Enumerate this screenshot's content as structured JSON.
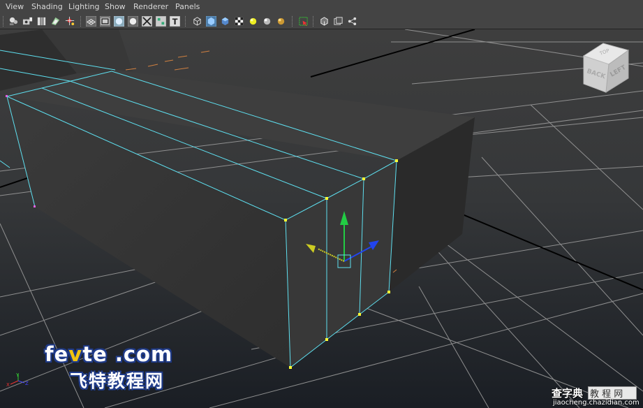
{
  "menu": [
    "View",
    "Shading",
    "Lighting",
    "Show",
    "Renderer",
    "Panels"
  ],
  "toolbar_icons": [
    "select-camera-icon",
    "camera-attributes-icon",
    "bookmark-icon",
    "image-plane-icon",
    "2d-pan-zoom-icon",
    "grid-icon",
    "film-gate-icon",
    "resolution-gate-icon",
    "gate-mask-icon",
    "field-chart-icon",
    "safe-action-icon",
    "wireframe-icon",
    "smooth-shade-icon",
    "default-material-icon",
    "textured-icon",
    "default-lighting-icon",
    "all-lights-icon",
    "shadows-icon",
    "isolate-select-icon",
    "xray-icon",
    "xray-joints-icon",
    "backface-culling-icon"
  ],
  "view_cube": {
    "top_label": "TOP",
    "face_left": "BACK",
    "face_right": "LEFT"
  },
  "axis_labels": {
    "x": "X",
    "y": "Y",
    "z": "Z"
  },
  "watermark": {
    "brand_pre": "fe",
    "brand_highlight": "v",
    "brand_post": "te .com",
    "brand_cn": "飞特教程网",
    "site_cn": "查字典",
    "site_box": "教 程 网",
    "site_url": "jiaocheng.chazidian.com"
  },
  "colors": {
    "background_top": "#3e3e3e",
    "background_bottom": "#1a1e24",
    "selection_edge": "#5ee0f0",
    "vertex": "#ffff33",
    "move_y": "#22cc44",
    "move_z": "#2244ee",
    "move_x": "#cccc22"
  }
}
